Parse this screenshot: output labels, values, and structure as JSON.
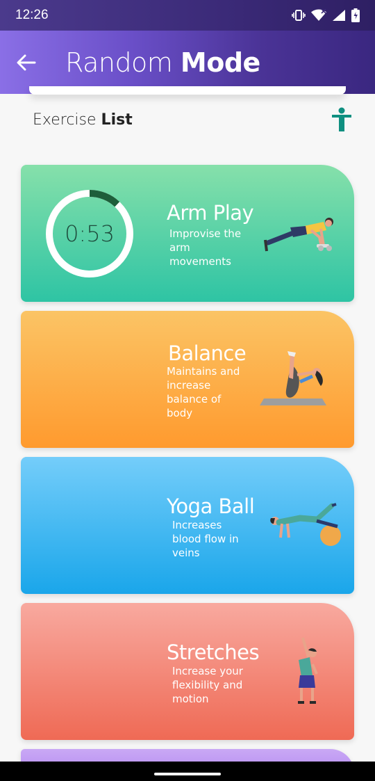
{
  "status_bar": {
    "time": "12:26"
  },
  "app_bar": {
    "title_light": "Random ",
    "title_bold": "Mode"
  },
  "section": {
    "title_light": "Exercise ",
    "title_bold": "List"
  },
  "cards": [
    {
      "title": "Arm Play",
      "description": "Improvise the arm movements",
      "timer": "0:53",
      "timer_progress": 0.12
    },
    {
      "title": "Balance",
      "description": "Maintains and increase balance of body"
    },
    {
      "title": "Yoga Ball",
      "description": "Increases blood flow in veins"
    },
    {
      "title": "Stretches",
      "description": "Increase your flexibility and motion"
    }
  ],
  "colors": {
    "accent": "#3a2780",
    "card_green": "#2ec4a4",
    "card_orange": "#ff9a2e",
    "card_blue": "#1aa6ea",
    "card_red": "#ef6a55",
    "card_purple": "#b58cf0",
    "icon_teal": "#0f8f80"
  }
}
